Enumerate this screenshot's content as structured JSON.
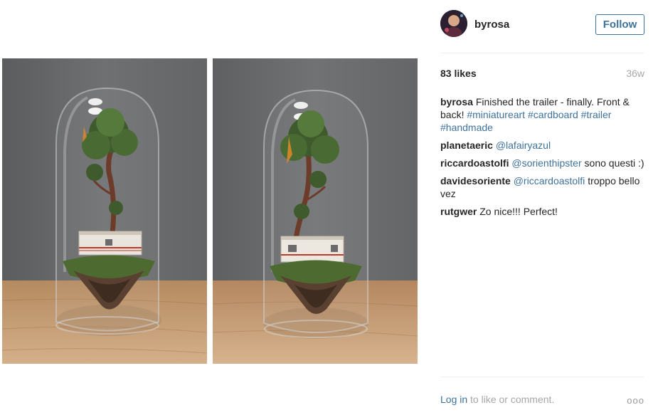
{
  "post": {
    "username": "byrosa",
    "follow_label": "Follow",
    "likes": "83 likes",
    "age": "36w",
    "caption": {
      "user": "byrosa",
      "text": "Finished the trailer - finally. Front & back!",
      "tags": [
        "#miniatureart",
        "#cardboard",
        "#trailer",
        "#handmade"
      ]
    },
    "comments": [
      {
        "user": "planetaeric",
        "mention": "@lafairyazul",
        "text": ""
      },
      {
        "user": "riccardoastolfi",
        "mention": "@sorienthipster",
        "text": "sono questi :)"
      },
      {
        "user": "davidesoriente",
        "mention": "@riccardoastolfi",
        "text": "troppo bello vez"
      },
      {
        "user": "rutgwer",
        "mention": "",
        "text": "Zo nice!!! Perfect!"
      }
    ],
    "footer": {
      "login_label": "Log in",
      "suffix": "to like or comment.",
      "more": "ooo"
    }
  },
  "icons": {
    "avatar": "avatar-image",
    "more": "more-options-icon"
  },
  "colors": {
    "link": "#3f729b",
    "muted": "#a5a7aa",
    "text": "#262626"
  }
}
